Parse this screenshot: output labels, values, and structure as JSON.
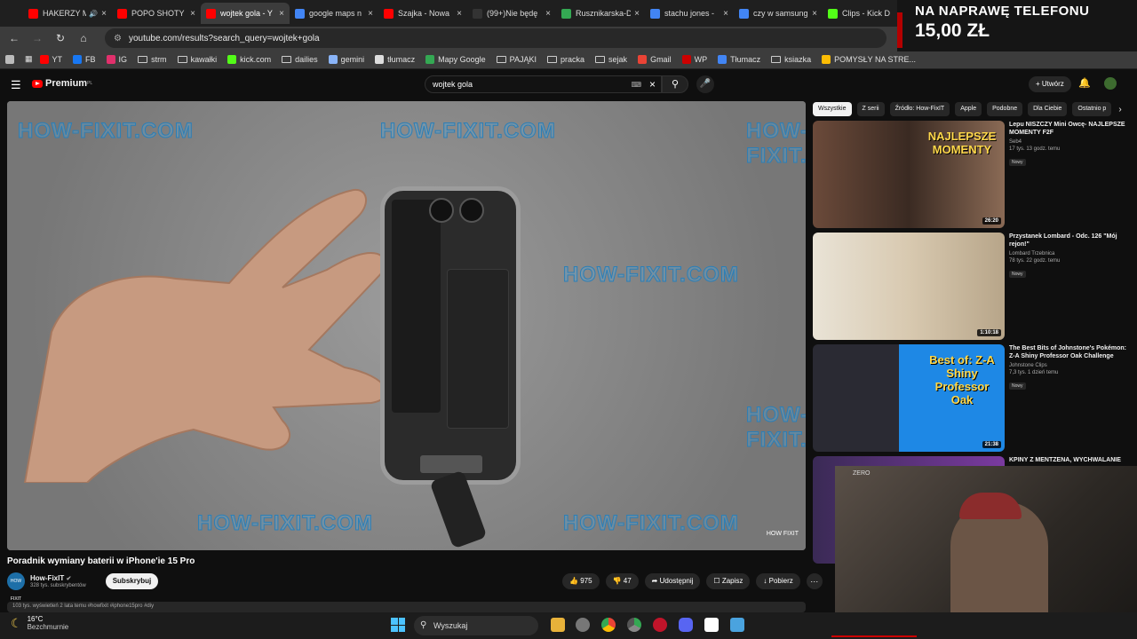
{
  "tabs": [
    {
      "title": "HAKERZY MAJĄ",
      "color": "#ff0000",
      "audio": true
    },
    {
      "title": "POPO SHOTY -",
      "color": "#ff0000"
    },
    {
      "title": "wojtek gola - Y",
      "color": "#ff0000",
      "active": true
    },
    {
      "title": "google maps n",
      "color": "#4285f4"
    },
    {
      "title": "Szajka - Nowa",
      "color": "#ff0000"
    },
    {
      "title": "(99+)Nie będę",
      "color": "#333333"
    },
    {
      "title": "Rusznikarska-D",
      "color": "#34a853"
    },
    {
      "title": "stachu jones -",
      "color": "#4285f4"
    },
    {
      "title": "czy w samsung",
      "color": "#4285f4"
    },
    {
      "title": "Clips - Kick D",
      "color": "#53fc18"
    }
  ],
  "stream_overlay": {
    "line1": "NA NAPRAWĘ TELEFONU",
    "line2": "15,00 ZŁ"
  },
  "address": {
    "url": "youtube.com/results?search_query=wojtek+gola"
  },
  "bookmarks": [
    {
      "label": "YT",
      "color": "#ff0000"
    },
    {
      "label": "FB",
      "color": "#1877f2"
    },
    {
      "label": "IG",
      "color": "#e1306c"
    },
    {
      "label": "strm",
      "folder": true
    },
    {
      "label": "kawałki",
      "folder": true
    },
    {
      "label": "kick.com",
      "color": "#53fc18"
    },
    {
      "label": "dailies",
      "folder": true
    },
    {
      "label": "gemini",
      "color": "#8ab4f8"
    },
    {
      "label": "tłumacz",
      "color": "#dddddd"
    },
    {
      "label": "Mapy Google",
      "color": "#34a853"
    },
    {
      "label": "PAJĄKI",
      "folder": true
    },
    {
      "label": "pracka",
      "folder": true
    },
    {
      "label": "sejak",
      "folder": true
    },
    {
      "label": "Gmail",
      "color": "#ea4335"
    },
    {
      "label": "WP",
      "color": "#cc0000"
    },
    {
      "label": "Tłumacz",
      "color": "#4285f4"
    },
    {
      "label": "ksiazka",
      "folder": true
    },
    {
      "label": "POMYSŁY NA STRE...",
      "color": "#fbbc04"
    }
  ],
  "yt": {
    "logo_text": "Premium",
    "logo_sup": "PL",
    "search_value": "wojtek gola",
    "create_label": "+ Utwórz"
  },
  "video": {
    "watermark": "HOW-FIXIT.COM",
    "corner_logo": "HOW FIXIT",
    "title": "Poradnik wymiany baterii w iPhone'ie 15 Pro",
    "channel": "How-FixIT",
    "channel_avatar": "HOW FIXIT",
    "subscribers": "328 tys. subskrybentów",
    "subscribe_label": "Subskrybuj",
    "likes": "975",
    "dislikes": "47",
    "share": "Udostępnij",
    "save": "Zapisz",
    "download": "Pobierz",
    "desc": "103 tys. wyświetleń  2 lata temu  #howfixit #iphone15pro #diy"
  },
  "chips": [
    "Wszystkie",
    "Z serii",
    "Źródło: How-FixIT",
    "Apple",
    "Podobne",
    "Dla Ciebie",
    "Ostatnio p"
  ],
  "recs": [
    {
      "title": "Lepu NISZCZY Mini Owcę- NAJLEPSZE MOMENTY F2F",
      "channel": "Seb4",
      "meta": "17 tys.  13 godz. temu",
      "badge": "Nowy",
      "duration": "26:20",
      "thumb": "linear-gradient(90deg,#6b4a3a,#3a2a22 50%,#8a6a55)",
      "caption": "NAJLEPSZE MOMENTY"
    },
    {
      "title": "Przystanek Lombard - Odc. 126 \"Mój rejon!\"",
      "channel": "Lombard Trzebnica",
      "meta": "78 tys.  22 godz. temu",
      "badge": "Nowy",
      "duration": "1:10:18",
      "thumb": "linear-gradient(90deg,#e9e3d6,#d8c9b0 50%,#b7a589)",
      "caption": ""
    },
    {
      "title": "The Best Bits of Johnstone's Pokémon: Z-A Shiny Professor Oak Challenge",
      "channel": "Johnstone Clips",
      "meta": "7,3 tys.  1 dzień temu",
      "badge": "Nowy",
      "duration": "21:38",
      "thumb": "linear-gradient(90deg,#2a2a33 45%,#1e88e5 45%)",
      "caption": "Best of: Z-A Shiny Professor Oak"
    },
    {
      "title": "KPINY Z MENTZENA, WYCHWALANIE",
      "channel": "",
      "meta": "",
      "badge": "",
      "duration": "",
      "thumb": "linear-gradient(90deg,#3a2a55,#7a3aa0)",
      "caption": ""
    }
  ],
  "webcam_tag": "ZERO",
  "taskbar": {
    "temp": "16°C",
    "condition": "Bezchmurnie",
    "search": "Wyszukaj"
  }
}
